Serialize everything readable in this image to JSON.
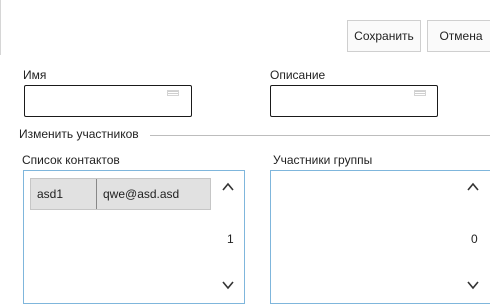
{
  "toolbar": {
    "save_label": "Сохранить",
    "cancel_label": "Отмена"
  },
  "form": {
    "name_label": "Имя",
    "name_value": "",
    "description_label": "Описание",
    "description_value": ""
  },
  "participants": {
    "section_title": "Изменить участников",
    "contacts": {
      "label": "Список контактов",
      "rows": [
        {
          "name": "asd1",
          "email": "qwe@asd.asd"
        }
      ],
      "page": "1"
    },
    "members": {
      "label": "Участники группы",
      "rows": [],
      "page": "0"
    }
  },
  "colors": {
    "list_border": "#7fb6dc",
    "row_background": "#e1e1e1"
  },
  "icons": [
    "chevron-up-icon",
    "chevron-down-icon",
    "resize-grip-icon"
  ]
}
